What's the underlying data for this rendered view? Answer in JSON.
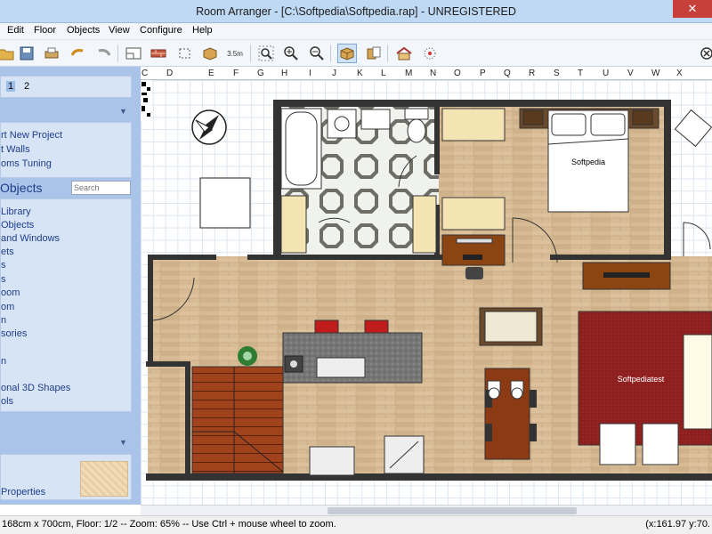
{
  "window": {
    "title": "Room Arranger - [C:\\Softpedia\\Softpedia.rap] - UNREGISTERED",
    "close_glyph": "✕"
  },
  "menu": [
    "Edit",
    "Floor",
    "Objects",
    "View",
    "Configure",
    "Help"
  ],
  "toolbar": {
    "dimension_label": "3.5m"
  },
  "ruler": {
    "columns": [
      "C",
      "D",
      "E",
      "F",
      "G",
      "H",
      "I",
      "J",
      "K",
      "L",
      "M",
      "N",
      "O",
      "P",
      "Q",
      "R",
      "S",
      "T",
      "U",
      "V",
      "W",
      "X"
    ]
  },
  "sidebar": {
    "pages": [
      "1",
      "2"
    ],
    "start_links": [
      "rt New Project",
      "t Walls",
      "oms Tuning"
    ],
    "objects_heading": "Objects",
    "search_placeholder": "Search",
    "object_links": [
      "Library",
      "Objects",
      "and Windows",
      "ets",
      "s",
      "s",
      "oom",
      "om",
      "n",
      "sories",
      "n",
      "onal 3D Shapes",
      "ols"
    ],
    "properties_label": "Properties"
  },
  "plan": {
    "bedroom_label": "Softpedia",
    "rug_label": "Softpediatest"
  },
  "status": {
    "message": "168cm x 700cm, Floor: 1/2 -- Zoom: 65% -- Use Ctrl + mouse wheel to zoom.",
    "coords": "(x:161.97 y:70."
  }
}
